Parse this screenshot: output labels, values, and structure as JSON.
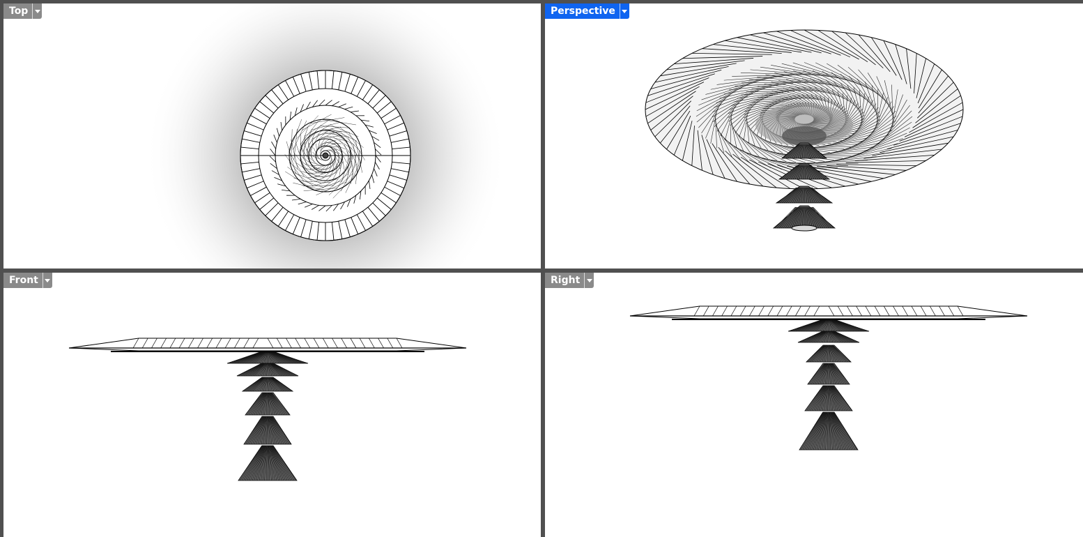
{
  "viewports": {
    "top": {
      "label": "Top",
      "active": false
    },
    "perspective": {
      "label": "Perspective",
      "active": true
    },
    "front": {
      "label": "Front",
      "active": false
    },
    "right": {
      "label": "Right",
      "active": false
    }
  },
  "colors": {
    "frame": "#505050",
    "active_tab": "#0f64f0",
    "inactive_tab": "#8a8a8a",
    "viewport_bg": "#ffffff",
    "wire": "#000000"
  },
  "icons": {
    "tab_dropdown": "chevron-down-icon"
  }
}
